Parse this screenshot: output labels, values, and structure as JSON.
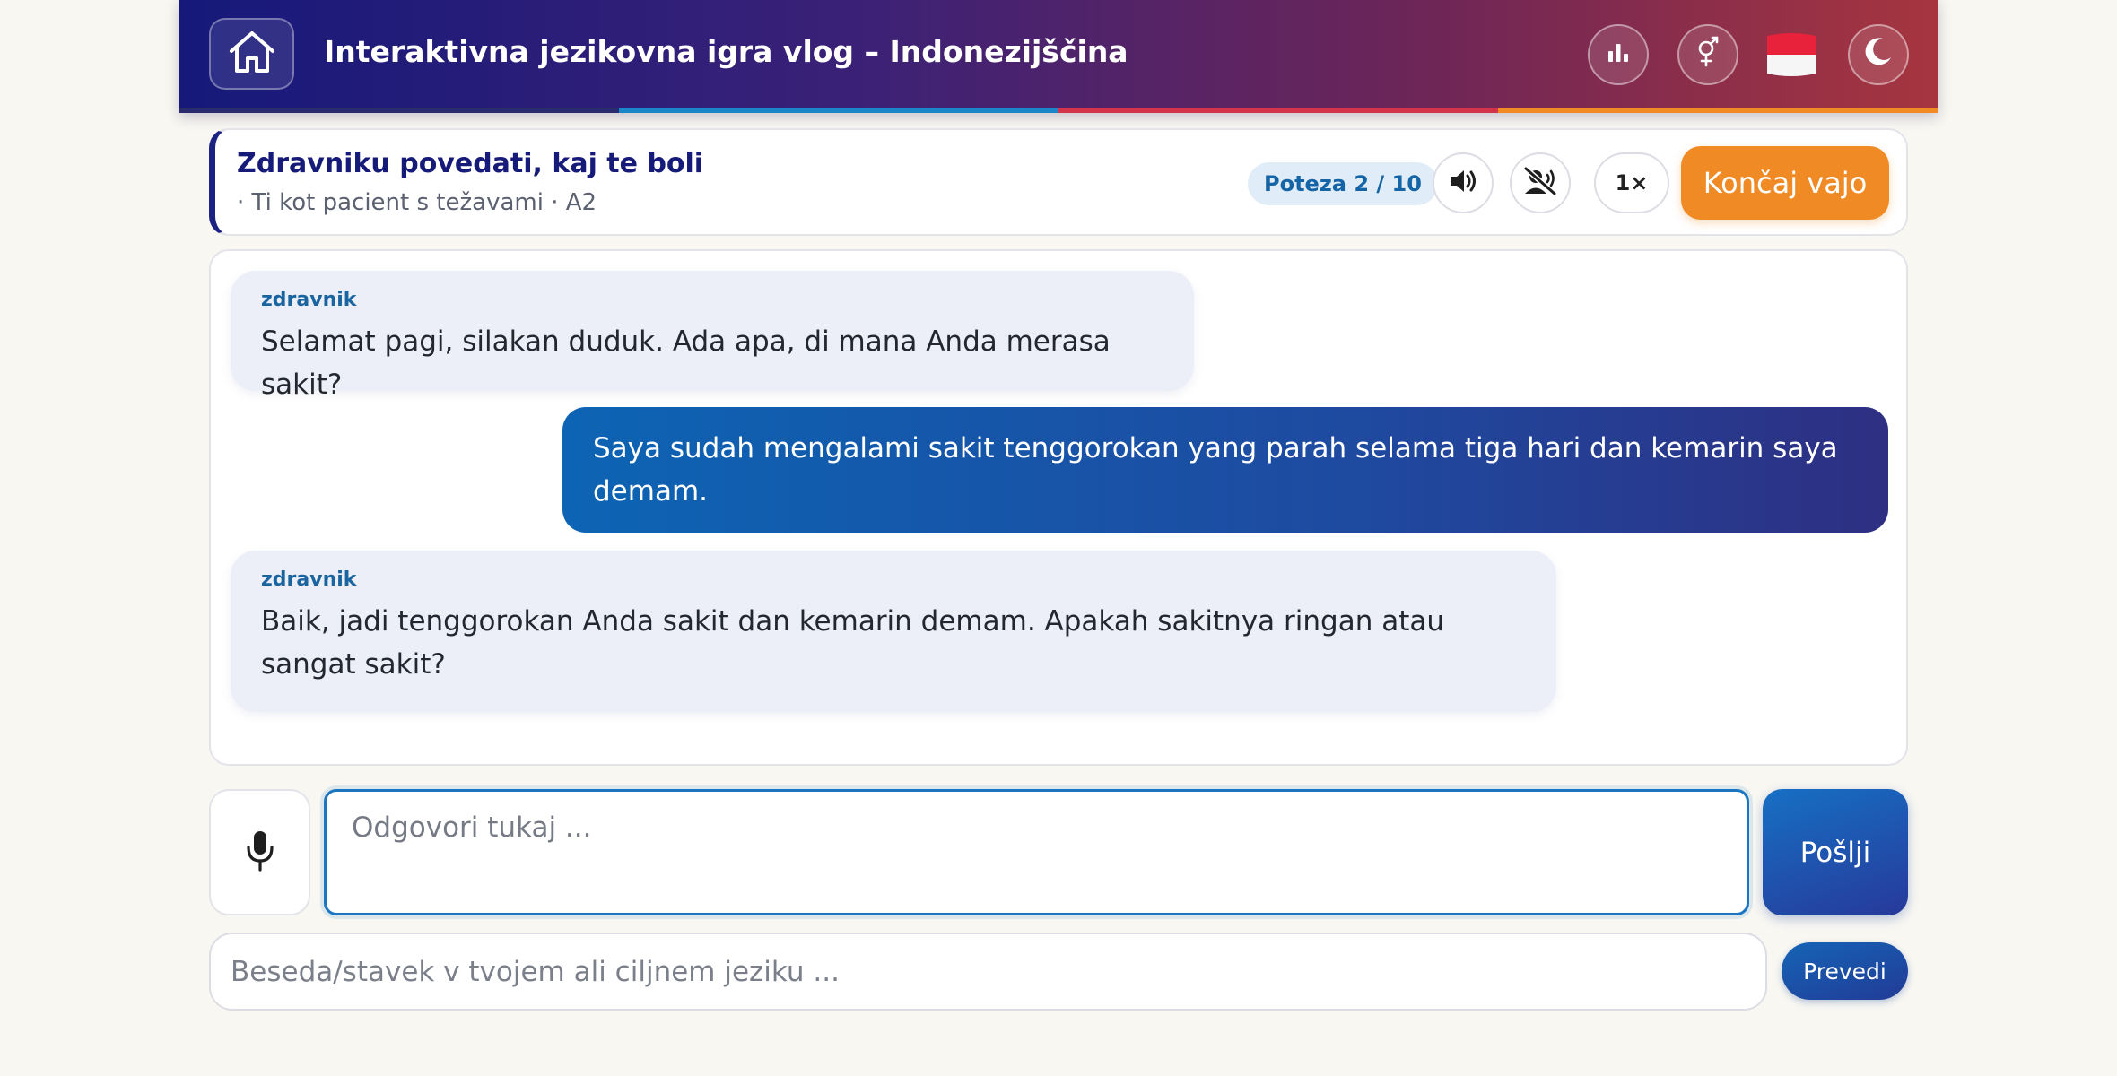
{
  "header": {
    "title": "Interaktivna jezikovna igra vlog – Indonezijščina",
    "home_icon": "home-icon",
    "buttons": [
      "bar-chart-icon",
      "gender-icon",
      "indonesia-flag-icon",
      "moon-icon"
    ],
    "stripe_colors": [
      "#2a2a6e",
      "#1a86c8",
      "#d2344a",
      "#f08a25"
    ]
  },
  "scenario": {
    "title": "Zdravniku povedati, kaj te boli",
    "subtitle": "· Ti kot pacient s težavami · A2",
    "turn": "Poteza 2 / 10",
    "speed": "1×",
    "end_label": "Končaj vajo",
    "icons": [
      "speaker-icon",
      "speaker-muted-icon"
    ]
  },
  "chat": {
    "messages": [
      {
        "role": "bot",
        "speaker": "zdravnik",
        "text": "Selamat pagi, silakan duduk. Ada apa, di mana Anda merasa sakit?"
      },
      {
        "role": "user",
        "text": "Saya sudah mengalami sakit tenggorokan yang parah selama tiga hari dan kemarin saya demam."
      },
      {
        "role": "bot",
        "speaker": "zdravnik",
        "text": "Baik, jadi tenggorokan Anda sakit dan kemarin demam. Apakah sakitnya ringan atau sangat sakit?"
      }
    ]
  },
  "composer": {
    "mic_icon": "microphone-icon",
    "placeholder": "Odgovori tukaj ...",
    "send_label": "Pošlji",
    "translate_placeholder": "Beseda/stavek v tvojem ali ciljnem jeziku ...",
    "translate_label": "Prevedi"
  },
  "colors": {
    "accent": "#1b75c0",
    "end_button": "#f08a25",
    "brand_navy": "#161a78"
  }
}
